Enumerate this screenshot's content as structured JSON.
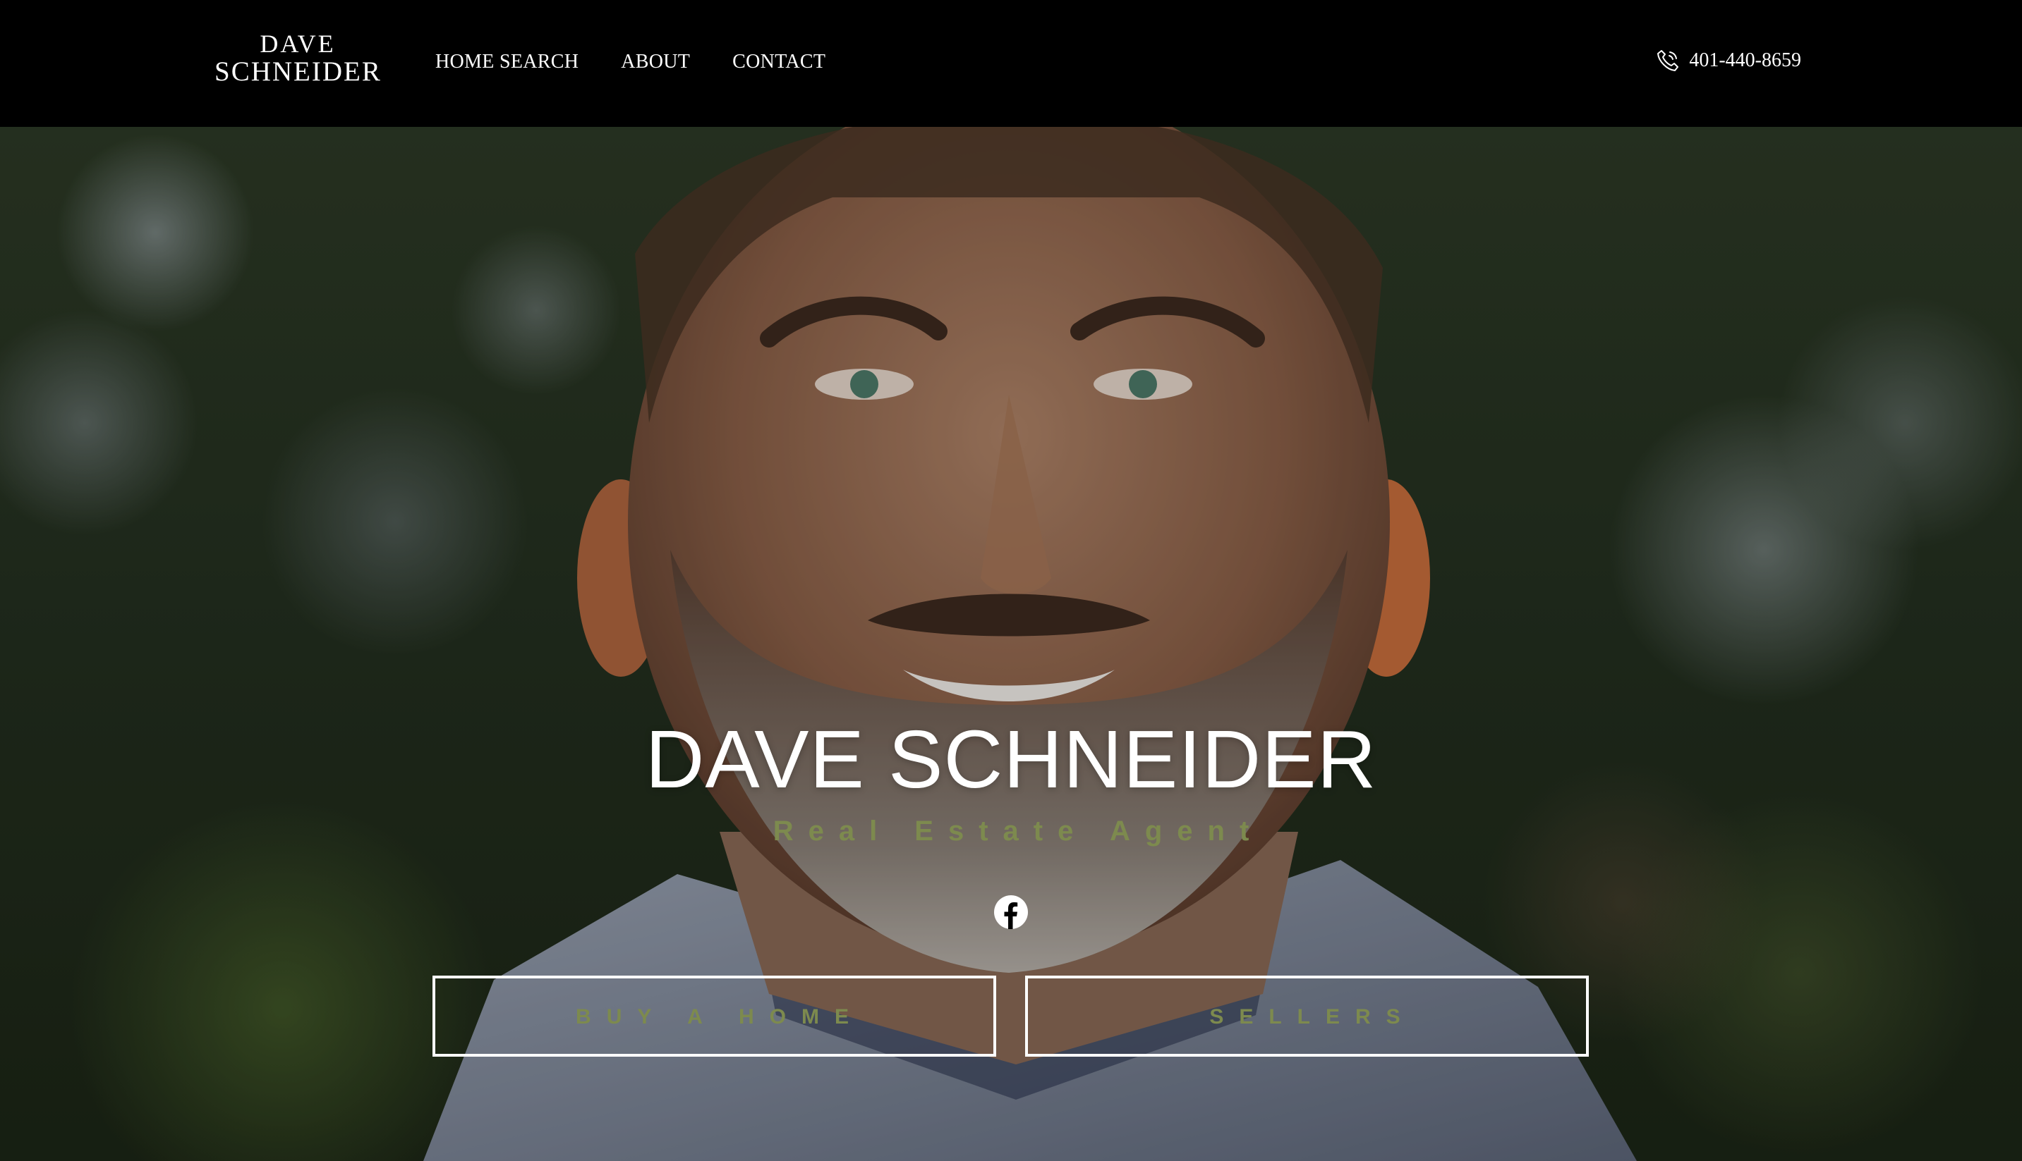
{
  "logo": {
    "line1": "DAVE",
    "line2": "SCHNEIDER"
  },
  "nav": {
    "items": [
      {
        "label": "HOME SEARCH"
      },
      {
        "label": "ABOUT"
      },
      {
        "label": "CONTACT"
      }
    ],
    "phone": "401-440-8659",
    "phone_icon": "phone-icon"
  },
  "hero": {
    "name": "DAVE SCHNEIDER",
    "title": "Real Estate Agent",
    "social_icon": "facebook-icon",
    "buttons": {
      "buy": "BUY A HOME",
      "sell": "SELLERS"
    }
  },
  "colors": {
    "nav_background": "#000000",
    "accent_green": "#7d8a4e",
    "text_white": "#ffffff"
  }
}
